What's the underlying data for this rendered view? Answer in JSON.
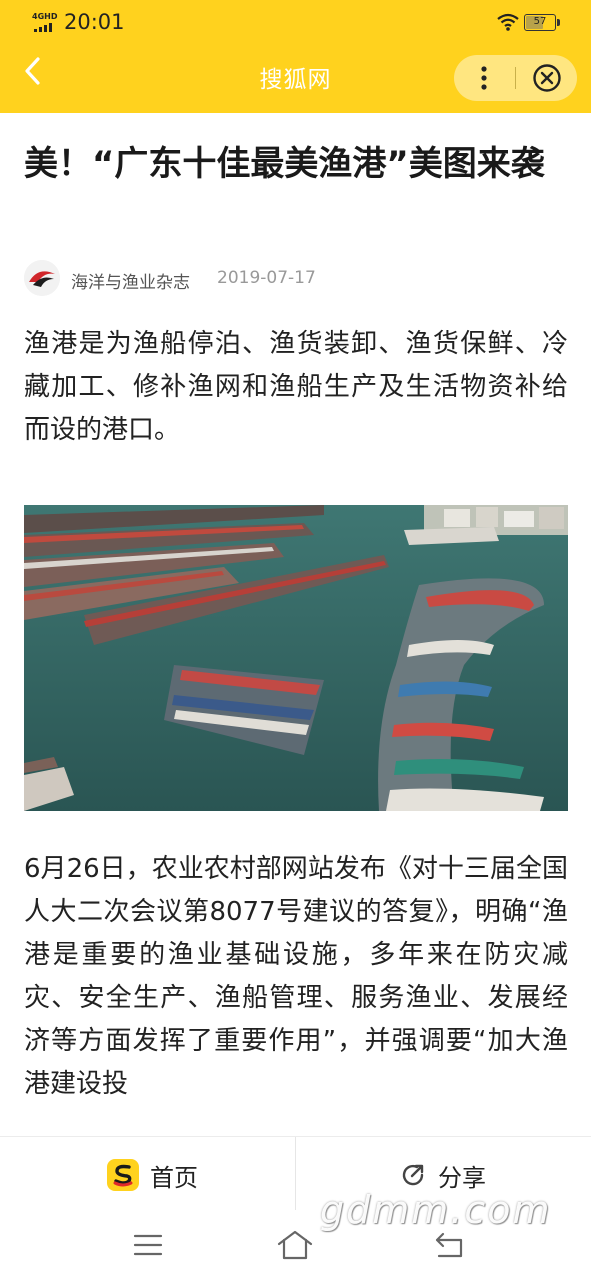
{
  "status_bar": {
    "network": "4GHD",
    "time": "20:01",
    "battery_level": "57"
  },
  "title_bar": {
    "title": "搜狐网"
  },
  "article": {
    "title": "美！“广东十佳最美渔港”美图来袭",
    "author": "海洋与渔业杂志",
    "date": "2019-07-17",
    "paragraph_1": "渔港是为渔船停泊、渔货装卸、渔货保鲜、冷藏加工、修补渔网和渔船生产及生活物资补给而设的港口。",
    "paragraph_2": "6月26日，农业农村部网站发布《对十三届全国人大二次会议第8077号建议的答复》，明确“渔港是重要的渔业基础设施，多年来在防灾减灾、安全生产、渔船管理、服务渔业、发展经济等方面发挥了重要作用”，并强调要“加大渔港建设投"
  },
  "bottom_bar": {
    "home_label": "首页",
    "share_label": "分享"
  },
  "watermark": "gdmm.com",
  "colors": {
    "brand_yellow": "#ffd21e",
    "capsule": "#ffe680",
    "water": "#2f5f5e"
  }
}
